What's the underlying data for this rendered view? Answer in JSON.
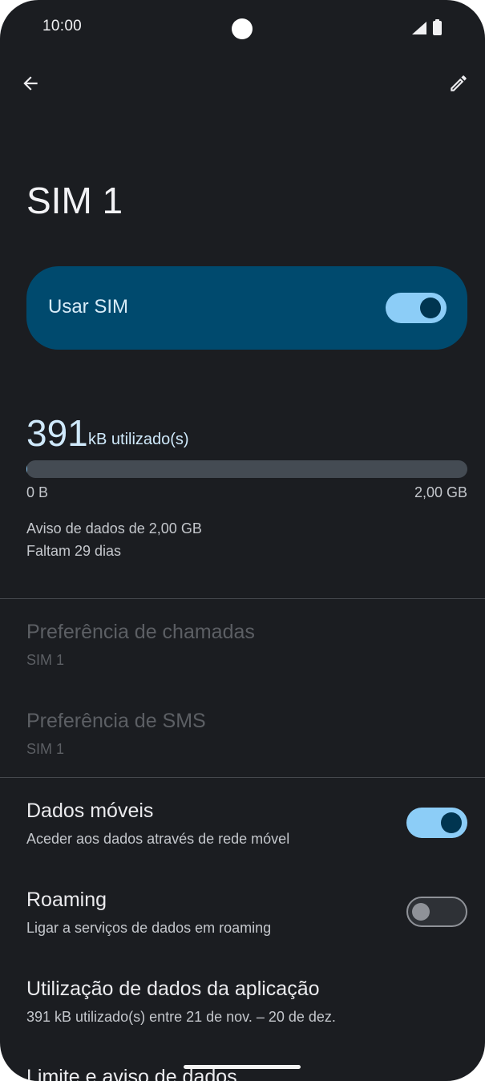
{
  "status_bar": {
    "time": "10:00",
    "icons": [
      "camera-cutout",
      "signal-icon",
      "battery-icon"
    ]
  },
  "app_bar": {
    "back_icon": "arrow-back-icon",
    "edit_icon": "pencil-icon"
  },
  "page": {
    "title": "SIM 1"
  },
  "use_sim": {
    "label": "Usar SIM",
    "enabled": true
  },
  "usage": {
    "amount": "391",
    "unit": "kB utilizado(s)",
    "min_label": "0 B",
    "max_label": "2,00 GB",
    "fill_fraction": 0.0002,
    "warning": "Aviso de dados de 2,00 GB",
    "remaining": "Faltam 29 dias"
  },
  "rows": {
    "call_pref": {
      "title": "Preferência de chamadas",
      "summary": "SIM 1",
      "enabled": false
    },
    "sms_pref": {
      "title": "Preferência de SMS",
      "summary": "SIM 1",
      "enabled": false
    },
    "mobile_data": {
      "title": "Dados móveis",
      "summary": "Aceder aos dados através de rede móvel",
      "checked": true
    },
    "roaming": {
      "title": "Roaming",
      "summary": "Ligar a serviços de dados em roaming",
      "checked": false
    },
    "app_data_usage": {
      "title": "Utilização de dados da aplicação",
      "summary": "391 kB utilizado(s) entre 21 de nov. – 20 de dez."
    },
    "data_limit": {
      "title": "Limite e aviso de dados"
    }
  },
  "colors": {
    "background": "#1b1d21",
    "card": "#004a6e",
    "accent": "#8ccdf7",
    "toggle_thumb_on": "#003550"
  }
}
